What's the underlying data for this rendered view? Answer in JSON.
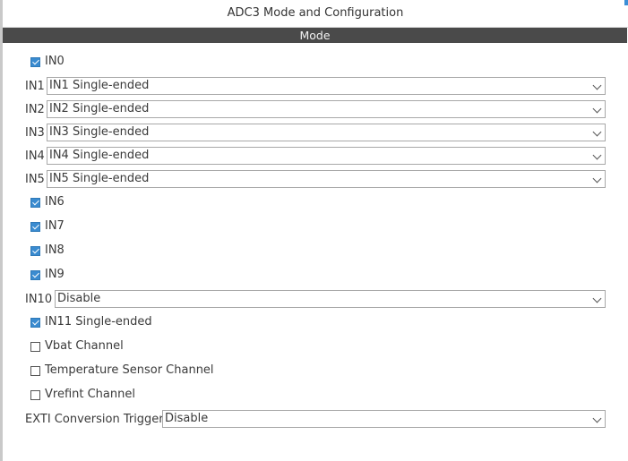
{
  "title": "ADC3 Mode and Configuration",
  "section": "Mode",
  "items": [
    {
      "type": "checkbox",
      "label": "IN0",
      "checked": true
    },
    {
      "type": "select",
      "label": "IN1",
      "value": "IN1 Single-ended"
    },
    {
      "type": "select",
      "label": "IN2",
      "value": "IN2 Single-ended"
    },
    {
      "type": "select",
      "label": "IN3",
      "value": "IN3 Single-ended"
    },
    {
      "type": "select",
      "label": "IN4",
      "value": "IN4 Single-ended"
    },
    {
      "type": "select",
      "label": "IN5",
      "value": "IN5 Single-ended"
    },
    {
      "type": "checkbox",
      "label": "IN6",
      "checked": true
    },
    {
      "type": "checkbox",
      "label": "IN7",
      "checked": true
    },
    {
      "type": "checkbox",
      "label": "IN8",
      "checked": true
    },
    {
      "type": "checkbox",
      "label": "IN9",
      "checked": true
    },
    {
      "type": "select",
      "label": "IN10",
      "value": "Disable"
    },
    {
      "type": "checkbox",
      "label": "IN11 Single-ended",
      "checked": true
    },
    {
      "type": "checkbox",
      "label": "Vbat Channel",
      "checked": false
    },
    {
      "type": "checkbox",
      "label": "Temperature Sensor Channel",
      "checked": false
    },
    {
      "type": "checkbox",
      "label": "Vrefint Channel",
      "checked": false
    },
    {
      "type": "select",
      "label": "EXTI Conversion Trigger",
      "value": "Disable"
    }
  ],
  "colors": {
    "checked": "#3a8bd0",
    "header_bar": "#4a4a4a"
  }
}
